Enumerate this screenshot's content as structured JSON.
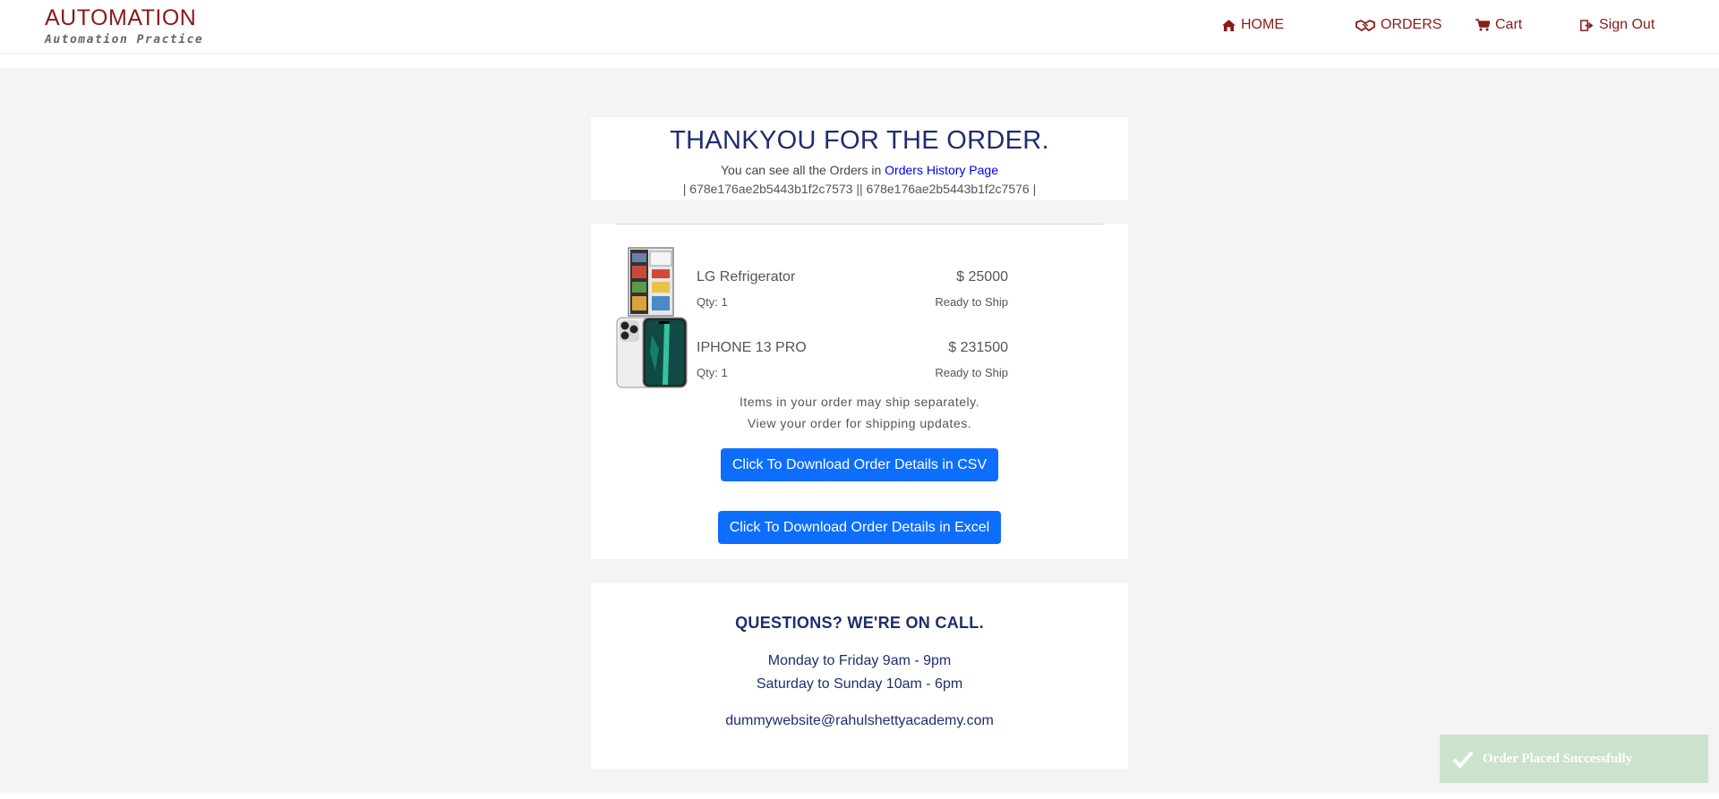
{
  "brand": {
    "title": "AUTOMATION",
    "subtitle": "Automation Practice"
  },
  "nav": {
    "home": "HOME",
    "orders": "ORDERS",
    "cart": "Cart",
    "signout": "Sign Out"
  },
  "confirmation": {
    "title": "THANKYOU FOR THE ORDER.",
    "history_prefix": "You can see all the Orders in ",
    "history_link": "Orders History Page",
    "order_ids": "| 678e176ae2b5443b1f2c7573 || 678e176ae2b5443b1f2c7576 |"
  },
  "items": [
    {
      "name": "LG Refrigerator",
      "price": "$ 25000",
      "qty": "Qty: 1",
      "status": "Ready to Ship",
      "icon": "refrigerator-image"
    },
    {
      "name": "IPHONE 13 PRO",
      "price": "$ 231500",
      "qty": "Qty: 1",
      "status": "Ready to Ship",
      "icon": "iphone-image"
    }
  ],
  "shipping_note": {
    "line1": "Items in your order may ship separately.",
    "line2": "View your order for shipping updates."
  },
  "buttons": {
    "csv": "Click To Download Order Details in CSV",
    "excel": "Click To Download Order Details in Excel"
  },
  "contact": {
    "heading": "QUESTIONS? WE'RE ON CALL.",
    "weekday": "Monday to Friday 9am - 9pm",
    "weekend": "Saturday to Sunday 10am - 6pm",
    "email": "dummywebsite@rahulshettyacademy.com"
  },
  "toast": {
    "message": "Order Placed Successfully",
    "icon": "check-icon"
  },
  "colors": {
    "brand": "#8b1a1a",
    "heading": "#1f2d6e",
    "button": "#0d6efd",
    "link": "#0000ee",
    "toast_bg": "#cbe3cc"
  }
}
